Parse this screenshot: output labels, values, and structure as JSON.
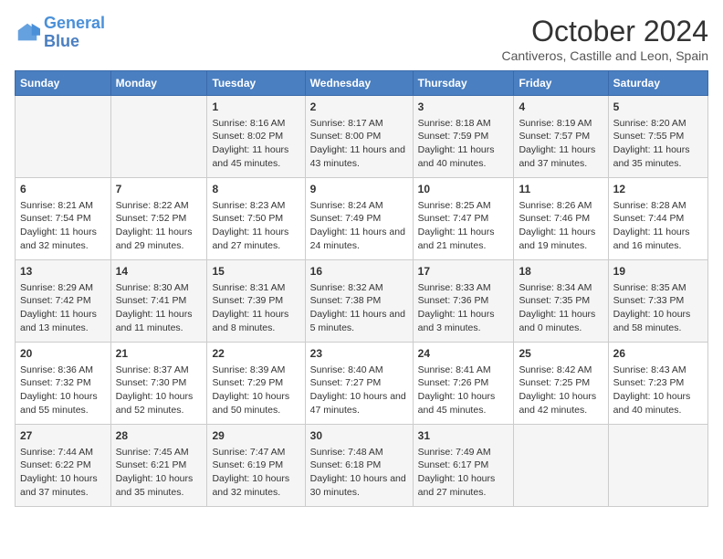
{
  "header": {
    "logo_general": "General",
    "logo_blue": "Blue",
    "main_title": "October 2024",
    "subtitle": "Cantiveros, Castille and Leon, Spain"
  },
  "days_of_week": [
    "Sunday",
    "Monday",
    "Tuesday",
    "Wednesday",
    "Thursday",
    "Friday",
    "Saturday"
  ],
  "weeks": [
    [
      {
        "day": "",
        "info": ""
      },
      {
        "day": "",
        "info": ""
      },
      {
        "day": "1",
        "info": "Sunrise: 8:16 AM\nSunset: 8:02 PM\nDaylight: 11 hours and 45 minutes."
      },
      {
        "day": "2",
        "info": "Sunrise: 8:17 AM\nSunset: 8:00 PM\nDaylight: 11 hours and 43 minutes."
      },
      {
        "day": "3",
        "info": "Sunrise: 8:18 AM\nSunset: 7:59 PM\nDaylight: 11 hours and 40 minutes."
      },
      {
        "day": "4",
        "info": "Sunrise: 8:19 AM\nSunset: 7:57 PM\nDaylight: 11 hours and 37 minutes."
      },
      {
        "day": "5",
        "info": "Sunrise: 8:20 AM\nSunset: 7:55 PM\nDaylight: 11 hours and 35 minutes."
      }
    ],
    [
      {
        "day": "6",
        "info": "Sunrise: 8:21 AM\nSunset: 7:54 PM\nDaylight: 11 hours and 32 minutes."
      },
      {
        "day": "7",
        "info": "Sunrise: 8:22 AM\nSunset: 7:52 PM\nDaylight: 11 hours and 29 minutes."
      },
      {
        "day": "8",
        "info": "Sunrise: 8:23 AM\nSunset: 7:50 PM\nDaylight: 11 hours and 27 minutes."
      },
      {
        "day": "9",
        "info": "Sunrise: 8:24 AM\nSunset: 7:49 PM\nDaylight: 11 hours and 24 minutes."
      },
      {
        "day": "10",
        "info": "Sunrise: 8:25 AM\nSunset: 7:47 PM\nDaylight: 11 hours and 21 minutes."
      },
      {
        "day": "11",
        "info": "Sunrise: 8:26 AM\nSunset: 7:46 PM\nDaylight: 11 hours and 19 minutes."
      },
      {
        "day": "12",
        "info": "Sunrise: 8:28 AM\nSunset: 7:44 PM\nDaylight: 11 hours and 16 minutes."
      }
    ],
    [
      {
        "day": "13",
        "info": "Sunrise: 8:29 AM\nSunset: 7:42 PM\nDaylight: 11 hours and 13 minutes."
      },
      {
        "day": "14",
        "info": "Sunrise: 8:30 AM\nSunset: 7:41 PM\nDaylight: 11 hours and 11 minutes."
      },
      {
        "day": "15",
        "info": "Sunrise: 8:31 AM\nSunset: 7:39 PM\nDaylight: 11 hours and 8 minutes."
      },
      {
        "day": "16",
        "info": "Sunrise: 8:32 AM\nSunset: 7:38 PM\nDaylight: 11 hours and 5 minutes."
      },
      {
        "day": "17",
        "info": "Sunrise: 8:33 AM\nSunset: 7:36 PM\nDaylight: 11 hours and 3 minutes."
      },
      {
        "day": "18",
        "info": "Sunrise: 8:34 AM\nSunset: 7:35 PM\nDaylight: 11 hours and 0 minutes."
      },
      {
        "day": "19",
        "info": "Sunrise: 8:35 AM\nSunset: 7:33 PM\nDaylight: 10 hours and 58 minutes."
      }
    ],
    [
      {
        "day": "20",
        "info": "Sunrise: 8:36 AM\nSunset: 7:32 PM\nDaylight: 10 hours and 55 minutes."
      },
      {
        "day": "21",
        "info": "Sunrise: 8:37 AM\nSunset: 7:30 PM\nDaylight: 10 hours and 52 minutes."
      },
      {
        "day": "22",
        "info": "Sunrise: 8:39 AM\nSunset: 7:29 PM\nDaylight: 10 hours and 50 minutes."
      },
      {
        "day": "23",
        "info": "Sunrise: 8:40 AM\nSunset: 7:27 PM\nDaylight: 10 hours and 47 minutes."
      },
      {
        "day": "24",
        "info": "Sunrise: 8:41 AM\nSunset: 7:26 PM\nDaylight: 10 hours and 45 minutes."
      },
      {
        "day": "25",
        "info": "Sunrise: 8:42 AM\nSunset: 7:25 PM\nDaylight: 10 hours and 42 minutes."
      },
      {
        "day": "26",
        "info": "Sunrise: 8:43 AM\nSunset: 7:23 PM\nDaylight: 10 hours and 40 minutes."
      }
    ],
    [
      {
        "day": "27",
        "info": "Sunrise: 7:44 AM\nSunset: 6:22 PM\nDaylight: 10 hours and 37 minutes."
      },
      {
        "day": "28",
        "info": "Sunrise: 7:45 AM\nSunset: 6:21 PM\nDaylight: 10 hours and 35 minutes."
      },
      {
        "day": "29",
        "info": "Sunrise: 7:47 AM\nSunset: 6:19 PM\nDaylight: 10 hours and 32 minutes."
      },
      {
        "day": "30",
        "info": "Sunrise: 7:48 AM\nSunset: 6:18 PM\nDaylight: 10 hours and 30 minutes."
      },
      {
        "day": "31",
        "info": "Sunrise: 7:49 AM\nSunset: 6:17 PM\nDaylight: 10 hours and 27 minutes."
      },
      {
        "day": "",
        "info": ""
      },
      {
        "day": "",
        "info": ""
      }
    ]
  ]
}
